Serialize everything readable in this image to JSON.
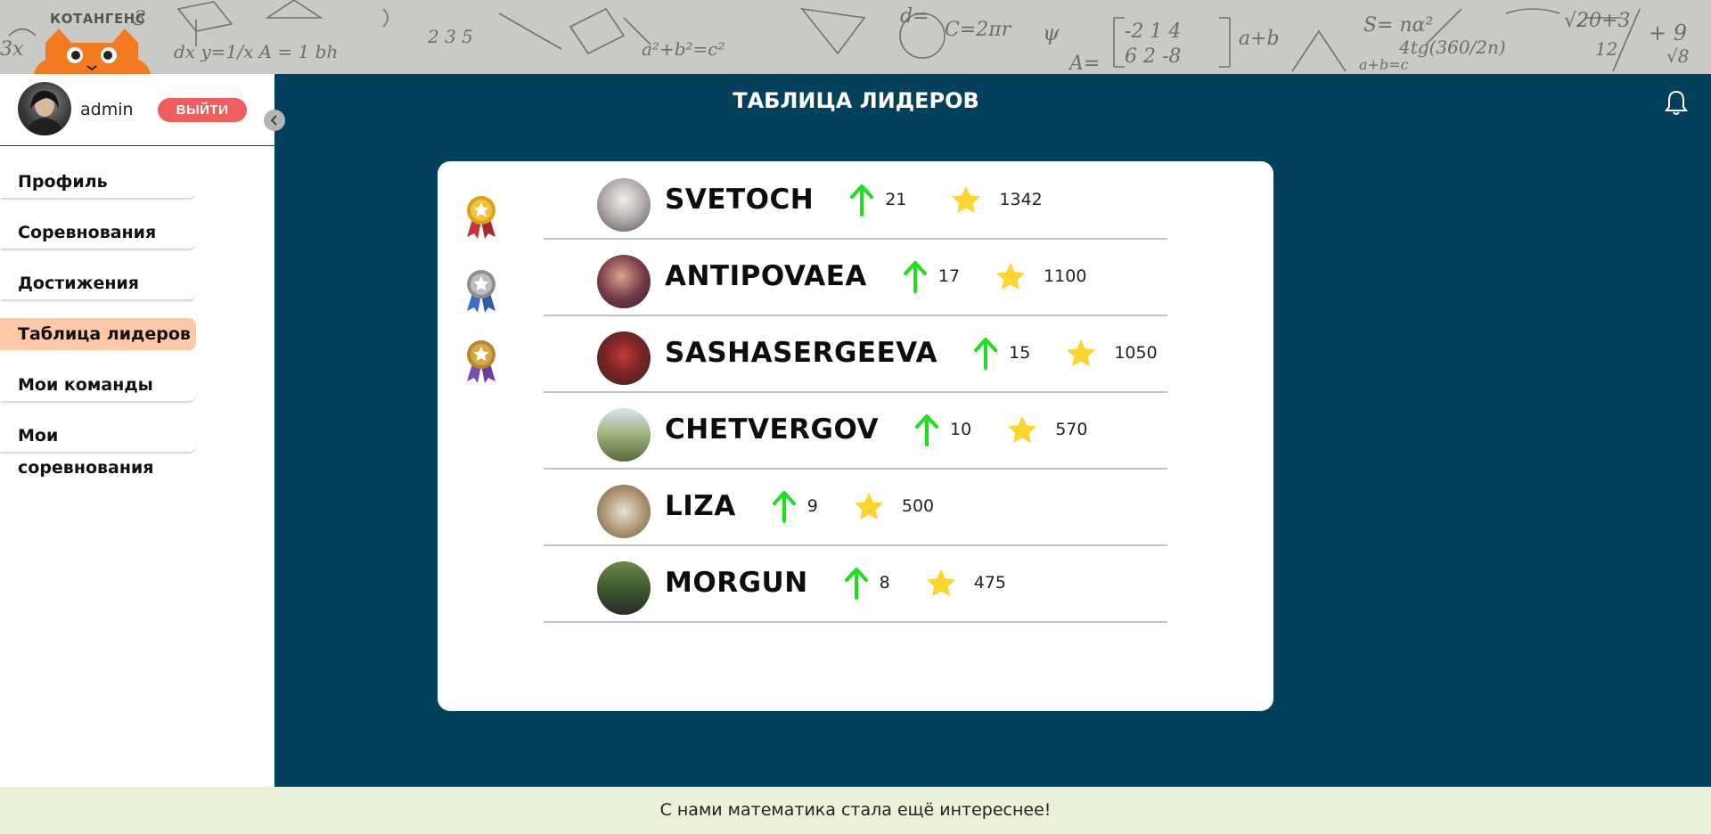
{
  "brand": {
    "name": "КОТАНГЕНС"
  },
  "user": {
    "name": "admin",
    "logout_label": "ВЫЙТИ"
  },
  "menu": [
    {
      "label": "Профиль",
      "active": false
    },
    {
      "label": "Соревнования",
      "active": false
    },
    {
      "label": "Достижения",
      "active": false
    },
    {
      "label": "Таблица лидеров",
      "active": true
    },
    {
      "label": "Мои команды",
      "active": false
    },
    {
      "label": "Мои соревнования",
      "active": false
    }
  ],
  "main": {
    "title": "ТАБЛИЦА ЛИДЕРОВ"
  },
  "leaders": [
    {
      "name": "SVETOCH",
      "level": "21",
      "stars": "1342",
      "medal": "gold"
    },
    {
      "name": "ANTIPOVAEA",
      "level": "17",
      "stars": "1100",
      "medal": "silver"
    },
    {
      "name": "SASHASERGEEVA",
      "level": "15",
      "stars": "1050",
      "medal": "bronze"
    },
    {
      "name": "CHETVERGOV",
      "level": "10",
      "stars": "570",
      "medal": ""
    },
    {
      "name": "LIZA",
      "level": "9",
      "stars": "500",
      "medal": ""
    },
    {
      "name": "MORGUN",
      "level": "8",
      "stars": "475",
      "medal": ""
    }
  ],
  "colors": {
    "main_bg": "#02405b",
    "accent_logout": "#ef5d5e",
    "active_menu": "#fec9a4",
    "arrow": "#1be01b",
    "star": "#fcd52e",
    "footer_bg": "#ebf0d8"
  },
  "icons": {
    "level": "arrow-up-icon",
    "stars": "star-icon",
    "notifications": "bell-icon",
    "collapse": "chevron-left-icon",
    "medals": "medal-icon"
  },
  "footer": {
    "text": "С нами математика стала ещё интереснее!"
  }
}
